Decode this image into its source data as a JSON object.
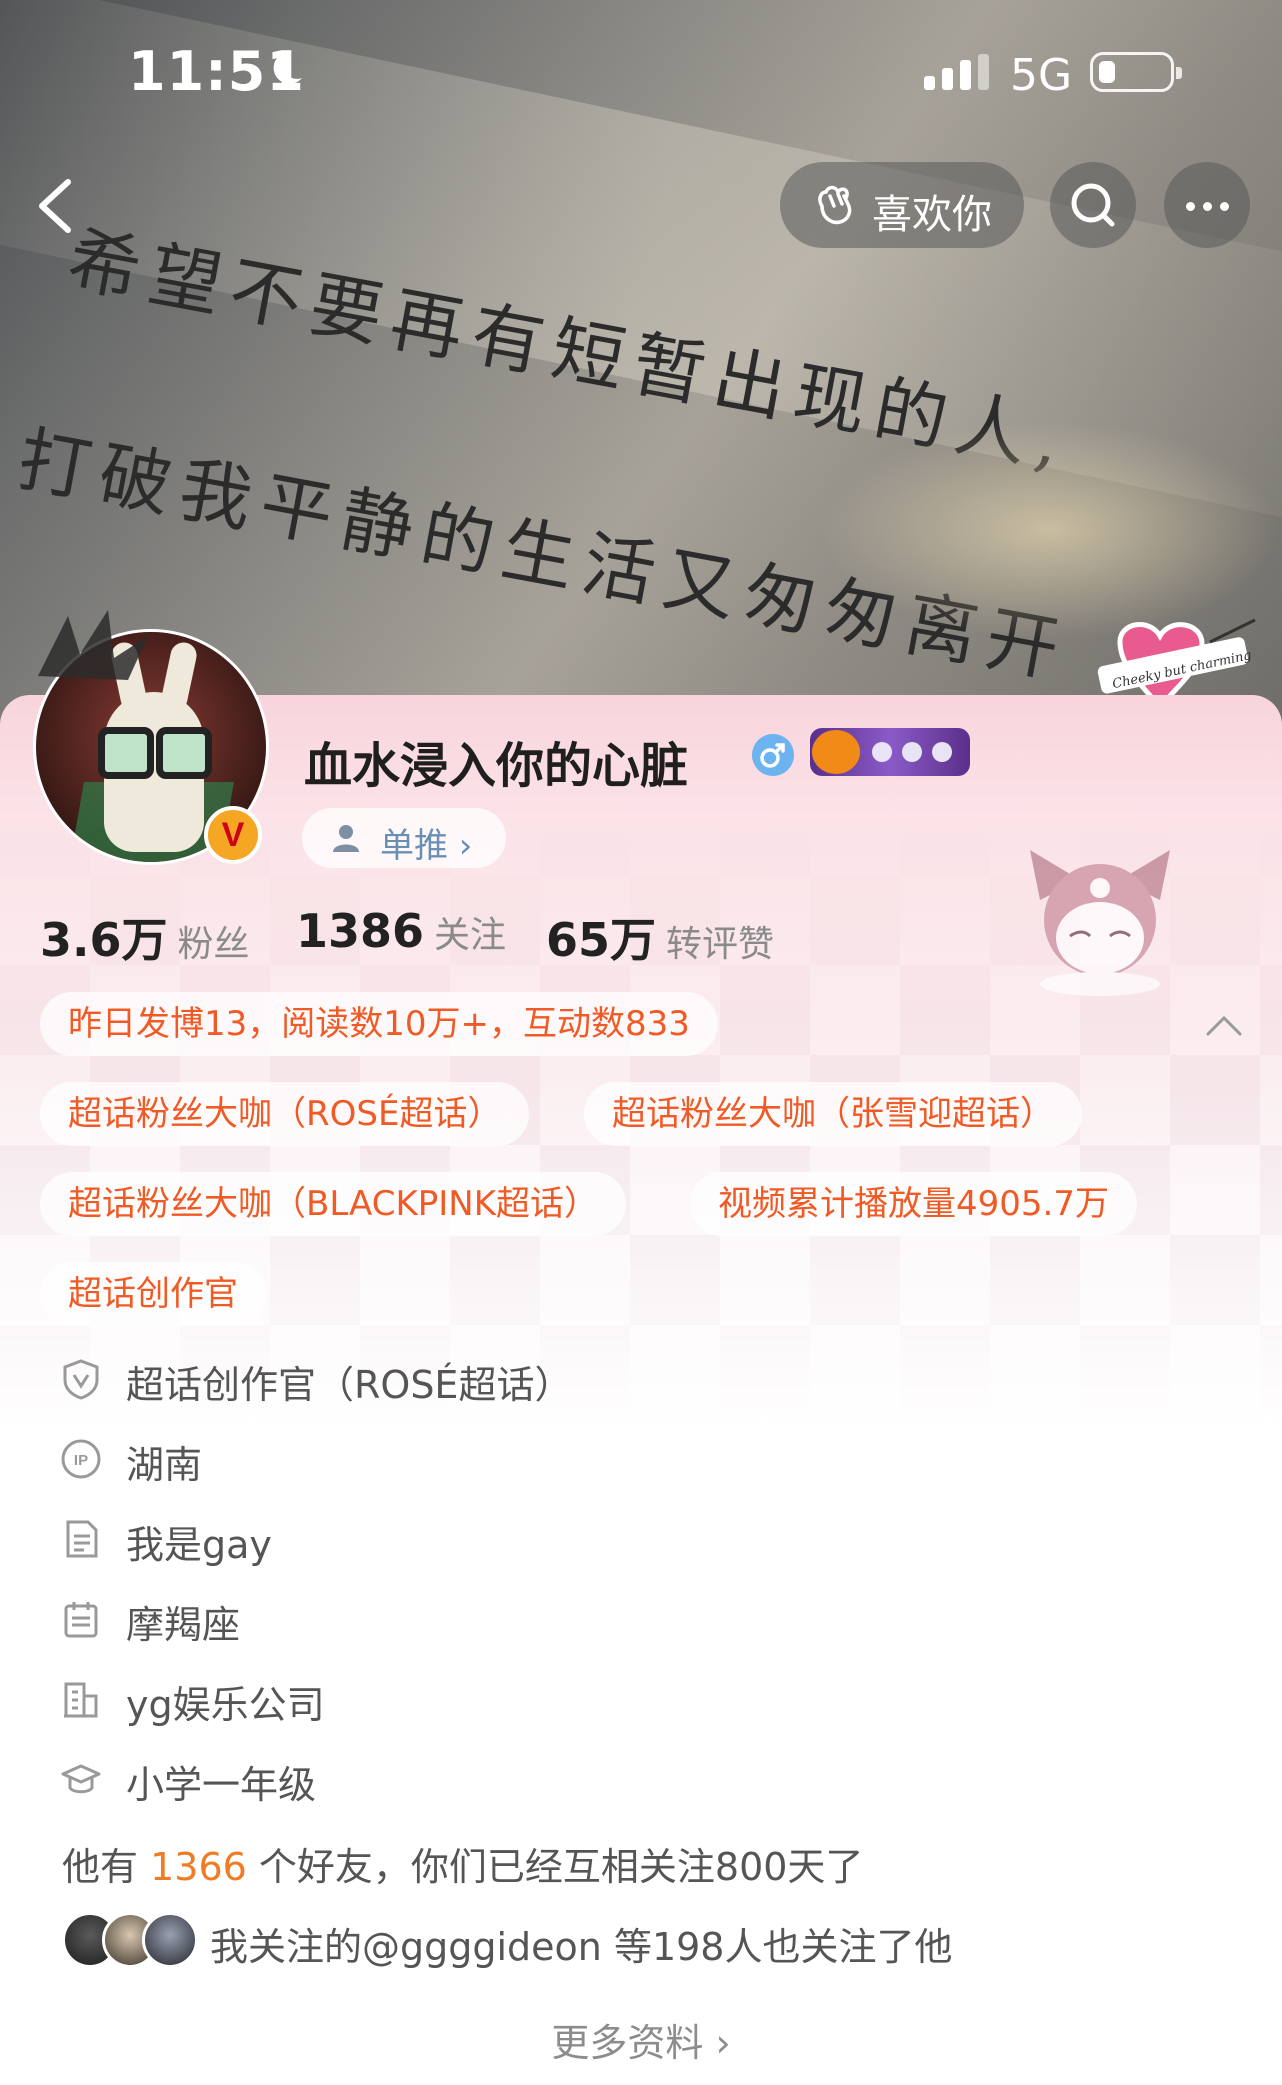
{
  "status_bar": {
    "time": "11:51",
    "network": "5G"
  },
  "banner": {
    "quote_line1": "希望不要再有短暂出现的人,",
    "quote_line2": "打破我平静的生活又匆匆离开",
    "sticker_text": "Cheeky but charming"
  },
  "nav": {
    "like_label": "喜欢你"
  },
  "profile": {
    "name": "血水浸入你的心脏",
    "verified_letter": "V",
    "single_push_label": "单推 ›"
  },
  "stats": {
    "fans_value": "3.6万",
    "fans_label": "粉丝",
    "following_value": "1386",
    "following_label": "关注",
    "interactions_value": "65万",
    "interactions_label": "转评赞"
  },
  "tags": {
    "daily": "昨日发博13，阅读数10万+，互动数833",
    "t1": "超话粉丝大咖（ROSÉ超话）",
    "t2": "超话粉丝大咖（张雪迎超话）",
    "t3": "超话粉丝大咖（BLACKPINK超话）",
    "t4": "视频累计播放量4905.7万",
    "t5": "超话创作官"
  },
  "info": {
    "badge": "超话创作官（ROSÉ超话）",
    "ip": "湖南",
    "bio": "我是gay",
    "zodiac": "摩羯座",
    "company": "yg娱乐公司",
    "school": "小学一年级"
  },
  "friends": {
    "prefix": "他有 ",
    "count": "1366",
    "suffix": " 个好友，你们已经互相关注800天了",
    "mutual_text": "我关注的@ggggideon 等198人也关注了他"
  },
  "more_label": "更多资料 ›",
  "colors": {
    "accent": "#f05a24",
    "link": "#f07b24",
    "badge": "#f5a623"
  }
}
